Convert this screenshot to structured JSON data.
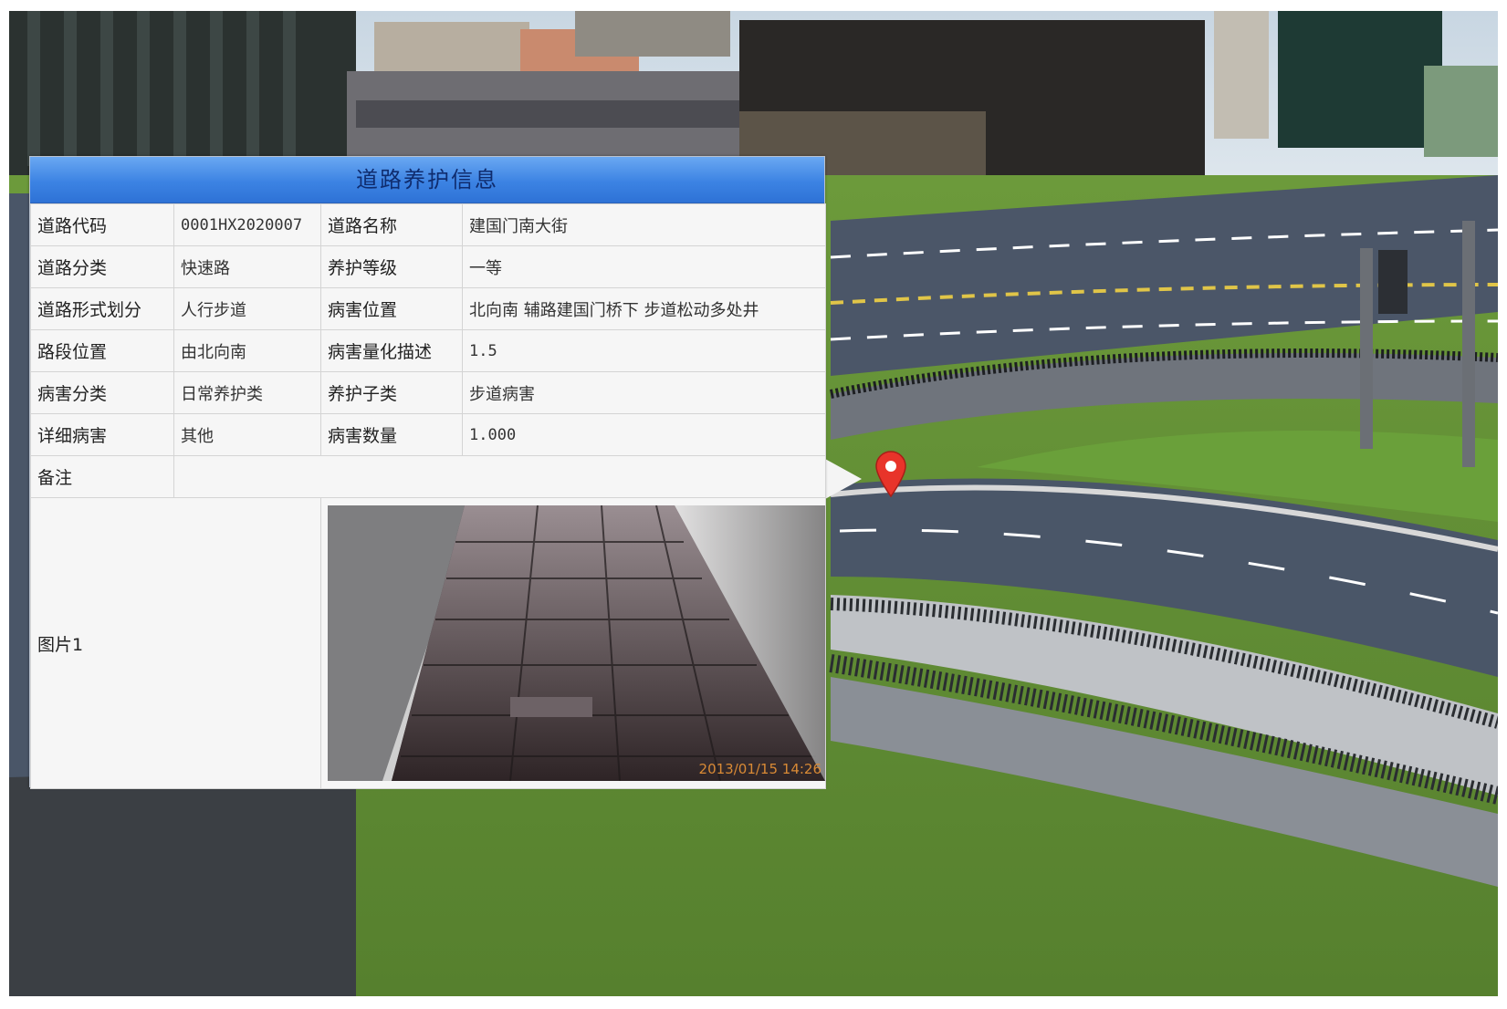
{
  "popup": {
    "title": "道路养护信息",
    "rows": [
      {
        "label1": "道路代码",
        "value1": "0001HX2020007",
        "label2": "道路名称",
        "value2": "建国门南大街"
      },
      {
        "label1": "道路分类",
        "value1": "快速路",
        "label2": "养护等级",
        "value2": "一等"
      },
      {
        "label1": "道路形式划分",
        "value1": "人行步道",
        "label2": "病害位置",
        "value2": "北向南  辅路建国门桥下  步道松动多处井"
      },
      {
        "label1": "路段位置",
        "value1": "由北向南",
        "label2": "病害量化描述",
        "value2": "1.5"
      },
      {
        "label1": "病害分类",
        "value1": "日常养护类",
        "label2": "养护子类",
        "value2": "步道病害"
      },
      {
        "label1": "详细病害",
        "value1": "其他",
        "label2": "病害数量",
        "value2": "1.000"
      }
    ],
    "remark_label": "备注",
    "remark_value": "",
    "photo_label": "图片1",
    "photo_timestamp": "2013/01/15 14:26"
  },
  "marker": {
    "icon": "map-pin-icon",
    "color": "#e8342a"
  },
  "colors": {
    "header": "#3c83e3",
    "grass": "#5f8a33",
    "road": "#4a5668"
  }
}
